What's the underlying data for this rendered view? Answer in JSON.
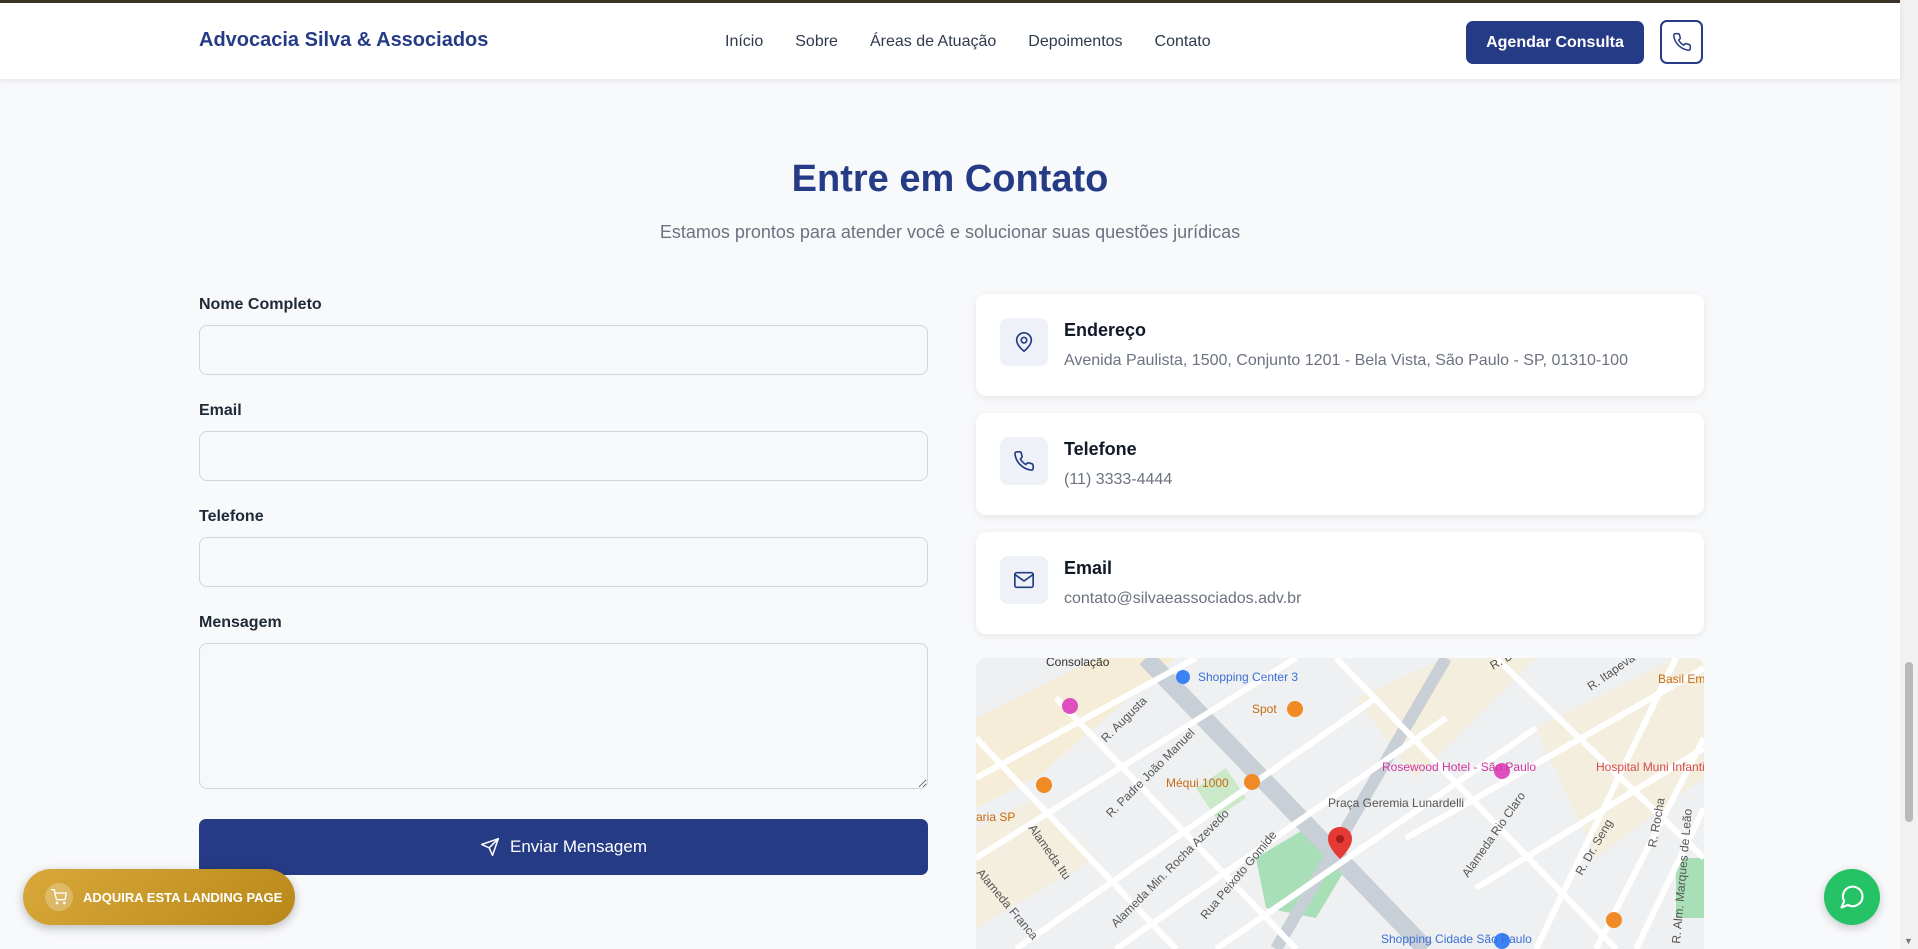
{
  "header": {
    "brand": "Advocacia Silva & Associados",
    "nav": [
      "Início",
      "Sobre",
      "Áreas de Atuação",
      "Depoimentos",
      "Contato"
    ],
    "cta_label": "Agendar Consulta"
  },
  "section": {
    "title": "Entre em Contato",
    "subtitle": "Estamos prontos para atender você e solucionar suas questões jurídicas"
  },
  "form": {
    "name_label": "Nome Completo",
    "email_label": "Email",
    "phone_label": "Telefone",
    "message_label": "Mensagem",
    "name_value": "",
    "email_value": "",
    "phone_value": "",
    "message_value": "",
    "submit_label": "Enviar Mensagem"
  },
  "contact": {
    "address": {
      "title": "Endereço",
      "value": "Avenida Paulista, 1500, Conjunto 1201 - Bela Vista, São Paulo - SP, 01310-100",
      "icon": "map-pin-icon"
    },
    "phone": {
      "title": "Telefone",
      "value": "(11) 3333-4444",
      "icon": "phone-icon"
    },
    "email": {
      "title": "Email",
      "value": "contato@silvaeassociados.adv.br",
      "icon": "mail-icon"
    }
  },
  "map": {
    "labels": [
      "Consolação",
      "Shopping Center 3",
      "Spot",
      "R. Augusta",
      "R. Padre João Manuel",
      "Méqui 1000",
      "aria SP",
      "Rosewood Hotel - São Paulo",
      "Praça Geremia Lunardelli",
      "Hospital Muni Infantil Menino J",
      "Basil Empório e R",
      "Alameda Itu",
      "Alameda Min. Rocha Azevedo",
      "Rua Peixoto Gomide",
      "Alameda Franca",
      "Alameda Rio Claro",
      "R. Dr. Seng",
      "R. Rocha",
      "R. Alm. Marques de Leão",
      "Shopping Cidade São Paulo",
      "R. Itapeva",
      "R. Dr."
    ]
  },
  "promo": {
    "label": "ADQUIRA ESTA LANDING PAGE"
  },
  "colors": {
    "primary": "#263b85",
    "gold": "#c99a2e",
    "whatsapp": "#25c266"
  }
}
